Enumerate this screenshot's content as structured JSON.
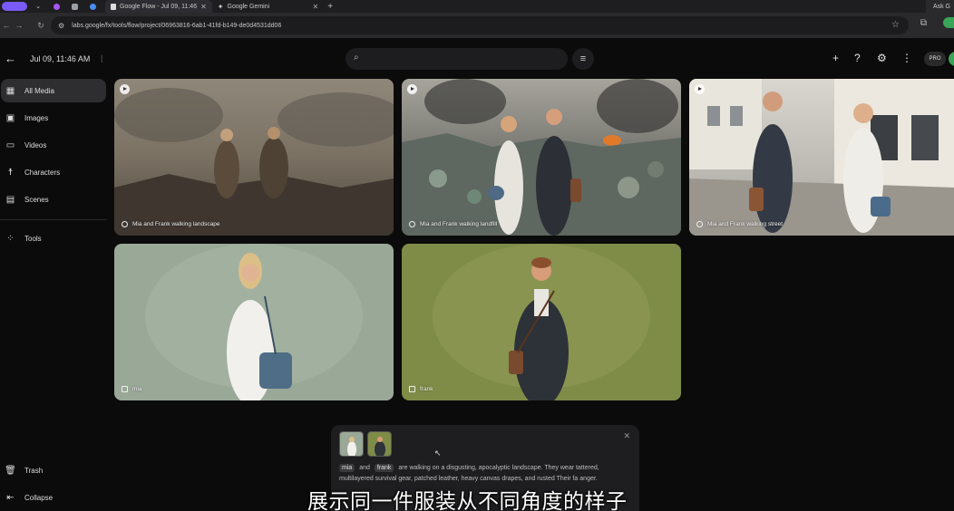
{
  "browser": {
    "tabs": [
      {
        "label": "Google Flow - Jul 09, 11:46",
        "active": true
      },
      {
        "label": "Google Gemini",
        "active": false
      }
    ],
    "ask_label": "Ask G",
    "url": "labs.google/fx/tools/flow/project/06963816-6ab1-41fd-b149-de0d4531dd06"
  },
  "header": {
    "date": "Jul 09, 11:46 AM",
    "pro_badge": "PRO",
    "search_placeholder": ""
  },
  "sidebar": {
    "items": [
      {
        "label": "All Media",
        "icon": "grid-icon",
        "active": true
      },
      {
        "label": "Images",
        "icon": "image-icon",
        "active": false
      },
      {
        "label": "Videos",
        "icon": "video-icon",
        "active": false
      },
      {
        "label": "Characters",
        "icon": "person-icon",
        "active": false
      },
      {
        "label": "Scenes",
        "icon": "film-icon",
        "active": false
      },
      {
        "label": "Tools",
        "icon": "tools-icon",
        "active": false
      },
      {
        "label": "Trash",
        "icon": "trash-icon",
        "active": false
      },
      {
        "label": "Collapse",
        "icon": "collapse-icon",
        "active": false
      }
    ]
  },
  "media": [
    {
      "caption": "Mia and Frank walking landscape",
      "kind": "video"
    },
    {
      "caption": "Mia and Frank walking landfill",
      "kind": "video"
    },
    {
      "caption": "Mia and Frank walking street",
      "kind": "video"
    },
    {
      "caption": "mia",
      "kind": "image"
    },
    {
      "caption": "frank",
      "kind": "image"
    }
  ],
  "prompt": {
    "chip1": "mia",
    "and": "and",
    "chip2": "frank",
    "text": "are walking on a disgusting, apocalyptic landscape. They wear tattered, multilayered survival gear, patched leather, heavy canvas drapes, and rusted",
    "text2": "Their fa",
    "text3": "anger."
  },
  "subtitle": "展示同一件服装从不同角度的样子",
  "colors": {
    "background": "#0b0b0b",
    "sidebar_active": "#2e2e30",
    "accent_avatar": "#3aa457",
    "tab_pill": "#7a5af8"
  }
}
